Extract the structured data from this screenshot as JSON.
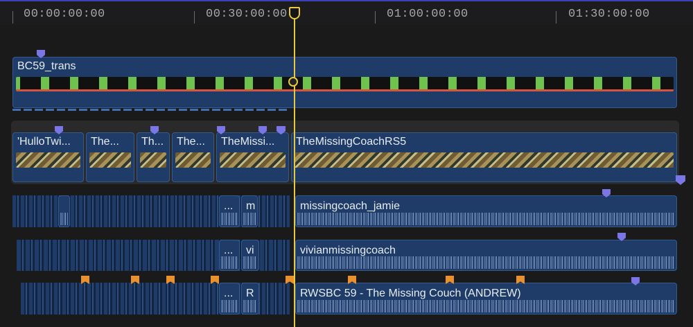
{
  "ruler": {
    "timecodes": [
      "00:00:00:00",
      "00:30:00:00",
      "01:00:00:00",
      "01:30:00:00"
    ]
  },
  "primary_clip": {
    "title": "BC59_trans"
  },
  "video_clips": [
    {
      "title": "'HulloTwi..."
    },
    {
      "title": "The..."
    },
    {
      "title": "Th..."
    },
    {
      "title": "The..."
    },
    {
      "title": "TheMissi..."
    },
    {
      "title": "TheMissingCoachRS5"
    }
  ],
  "audio_lane_1": {
    "short": [
      "...",
      "m"
    ],
    "main": "missingcoach_jamie"
  },
  "audio_lane_2": {
    "short": [
      "...",
      "vi"
    ],
    "main": "vivianmissingcoach"
  },
  "audio_lane_3": {
    "short": [
      "...",
      "R"
    ],
    "main": "RWSBC 59 - The Missing Couch (ANDREW)"
  },
  "colors": {
    "playhead": "#e6c93c",
    "clip": "#1f3c68",
    "marker": "#7a76e6",
    "chapter_marker": "#e8912d"
  }
}
